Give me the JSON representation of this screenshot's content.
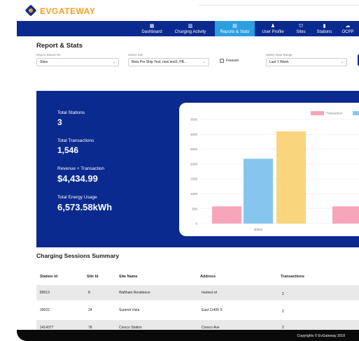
{
  "brand": {
    "ev": "EV",
    "gateway": "GATEWAY"
  },
  "nav": [
    {
      "label": "Dashboard",
      "icon": "dashboard-icon",
      "glyph": "▦"
    },
    {
      "label": "Charging Activity",
      "icon": "bar-chart-icon",
      "glyph": "▥"
    },
    {
      "label": "Reports & Stats",
      "icon": "report-icon",
      "glyph": "▤",
      "active": true
    },
    {
      "label": "User Profile",
      "icon": "users-icon",
      "glyph": "♟"
    },
    {
      "label": "Sites",
      "icon": "sites-icon",
      "glyph": "⛫"
    },
    {
      "label": "Stations",
      "icon": "stations-icon",
      "glyph": "▮"
    },
    {
      "label": "OCPP",
      "icon": "cloud-icon",
      "glyph": "☁"
    }
  ],
  "page": {
    "title": "Report & Stats"
  },
  "filters": {
    "report_based_on": {
      "label": "Report Based On",
      "value": "Sites"
    },
    "select_site": {
      "label": "Select Site",
      "value": "Beta Pre Ship Test, new test3, PB..."
    },
    "freeven": {
      "label": "Freeven"
    },
    "date_range": {
      "label": "Select Date Range",
      "value": "Last 1 Week"
    }
  },
  "stats": {
    "total_stations": {
      "label": "Total Stations",
      "value": "3"
    },
    "total_transactions": {
      "label": "Total Transactions",
      "value": "1,546"
    },
    "revenue": {
      "label": "Revenue + Transaction",
      "value": "$4,434.99"
    },
    "energy": {
      "label": "Total Energy Usage",
      "value": "6,573.58kWh"
    }
  },
  "chart_data": {
    "type": "bar",
    "title": "",
    "xlabel": "",
    "ylabel": "",
    "ylim": [
      0,
      3500
    ],
    "yticks": [
      "0",
      "500",
      "1000",
      "1500",
      "2000",
      "2500",
      "3000",
      "3500"
    ],
    "legend_position": "top-right",
    "legend": [
      "Transaction",
      ""
    ],
    "categories": [
      "30001",
      ""
    ],
    "bars": [
      {
        "category": "30001",
        "value": 580,
        "color": "#f7a6ba"
      },
      {
        "category": "30001",
        "value": 2180,
        "color": "#86c6ee"
      },
      {
        "category": "30001",
        "value": 3100,
        "color": "#f9d57e"
      },
      {
        "category": "",
        "value": 580,
        "color": "#f7a6ba"
      }
    ],
    "legend_colors": [
      "#f7a6ba",
      "#86c6ee"
    ]
  },
  "sessions": {
    "title": "Charging Sessions Summary",
    "columns": [
      "Station Id",
      "Site Id",
      "Site Name",
      "Address",
      "Transactions"
    ],
    "rows": [
      [
        "80013",
        "8",
        "Waltham Residence",
        "hoolext rd",
        "2"
      ],
      [
        "30022",
        "24",
        "Summit Vista",
        "East 11400 S",
        "2"
      ],
      [
        "1414377",
        "78",
        "Cresco Station",
        "Cresco Ave",
        "2"
      ]
    ]
  },
  "footer": {
    "text": "Copyrights © EvGateway 2018"
  }
}
